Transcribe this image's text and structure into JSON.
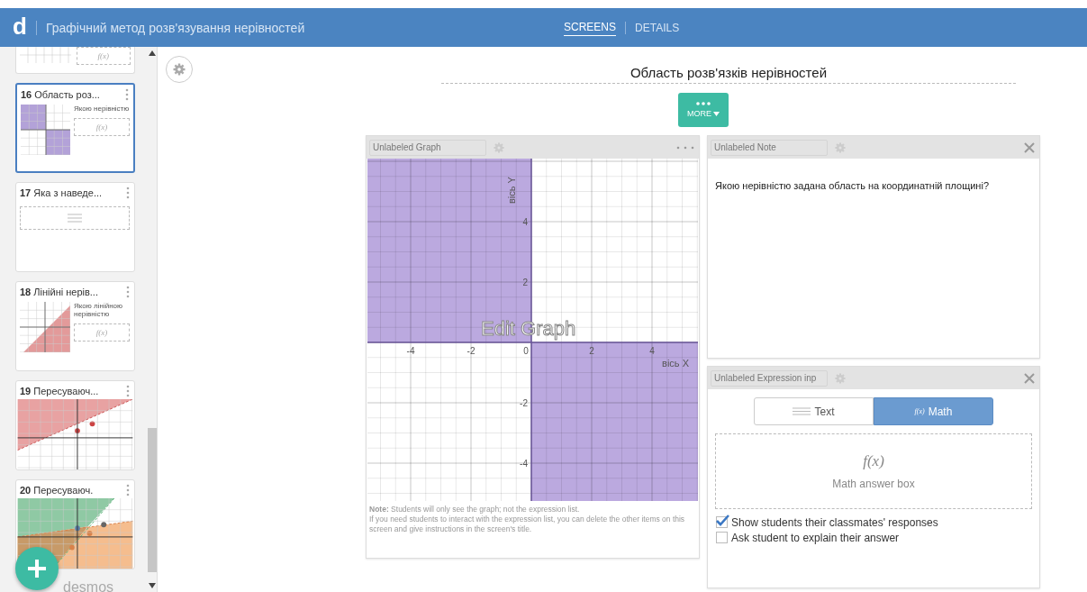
{
  "header": {
    "logo": "d",
    "title": "Графічний метод розв'язування нерівностей",
    "tabs": [
      {
        "label": "SCREENS",
        "selected": true
      },
      {
        "label": "DETAILS",
        "selected": false
      }
    ]
  },
  "slides": [
    {
      "kind": "partial",
      "answer": "f(x)",
      "selected": false
    },
    {
      "kind": "quadrants",
      "number": "16",
      "title": "Область роз...",
      "prompt": "Якою нерівністю",
      "answer": "f(x)",
      "selected": true
    },
    {
      "kind": "choice",
      "number": "17",
      "title": "Яка з наведе...",
      "selected": false
    },
    {
      "kind": "halfplane",
      "number": "18",
      "title": "Лінійні нерів...",
      "prompt": "Якою лінійною нерівністю",
      "answer": "f(x)",
      "selected": false
    },
    {
      "kind": "graph-red",
      "number": "19",
      "title": "Пересуваюч...",
      "selected": false
    },
    {
      "kind": "graph-mixed",
      "number": "20",
      "title": "Пересуваюч.",
      "selected": false
    }
  ],
  "brand": "desmos",
  "screen": {
    "title": "Область розв'язків нерівностей",
    "more_label": "MORE"
  },
  "graph_panel": {
    "label": "Unlabeled Graph",
    "x_ticks": [
      "-4",
      "-2",
      "0",
      "2",
      "4"
    ],
    "y_ticks": [
      "4",
      "2",
      "-2",
      "-4"
    ],
    "x_axis_label": "вісь X",
    "y_axis_label": "вісь Y",
    "overlay": "Edit Graph",
    "note_lines": [
      "**Note:** Students will only see the graph; not the expression list.",
      "If you need students to interact with the expression list, you can delete the other items on this screen and give instructions in the screen's title."
    ]
  },
  "note_panel": {
    "label": "Unlabeled Note",
    "text": "Якою нерівністю задана область на координатній площині?"
  },
  "expression_panel": {
    "label": "Unlabeled Expression inp",
    "modes": [
      {
        "kind": "text",
        "label": "Text",
        "selected": false
      },
      {
        "kind": "math",
        "icon_text": "f(x)",
        "label": "Math",
        "selected": true
      }
    ],
    "answer_box": {
      "symbol": "f(x)",
      "caption": "Math answer box"
    },
    "options": [
      {
        "label": "Show students their classmates' responses",
        "checked": true
      },
      {
        "label": "Ask student to explain their answer",
        "checked": false
      }
    ]
  }
}
